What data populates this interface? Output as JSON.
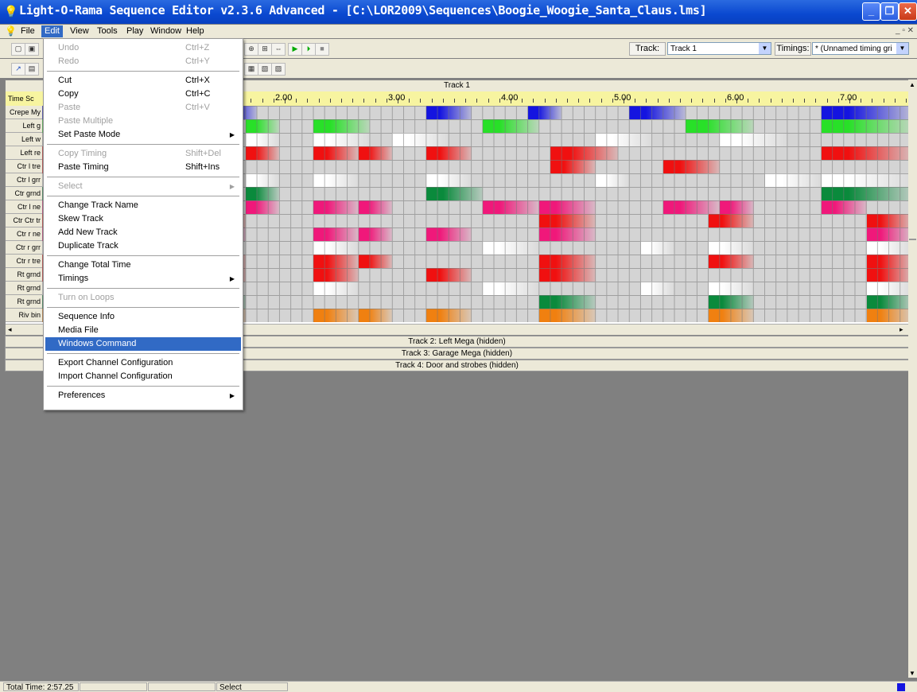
{
  "window": {
    "title": "Light-O-Rama Sequence Editor v2.3.6 Advanced - [C:\\LOR2009\\Sequences\\Boogie_Woogie_Santa_Claus.lms]"
  },
  "menubar": [
    "File",
    "Edit",
    "View",
    "Tools",
    "Play",
    "Window",
    "Help"
  ],
  "toolbar": {
    "track_label": "Track:",
    "track_value": "Track 1",
    "timings_label": "Timings:",
    "timings_value": "* (Unnamed timing gri"
  },
  "editor": {
    "track_title": "Track 1",
    "timescale_label": "Time Sc",
    "time_ticks": [
      "2.00",
      "3.00",
      "4.00",
      "5.00",
      "6.00",
      "7.00"
    ],
    "channel_labels": [
      "Crepe My",
      "Left g",
      "Left w",
      "Left re",
      "Ctr l tre",
      "Ctr l grr",
      "Ctr grnd",
      "Ctr l ne",
      "Ctr Ctr tr",
      "Ctr r ne",
      "Ctr r grr",
      "Ctr r tre",
      "Rt grnd",
      "Rt grnd",
      "Rt grnd",
      "Riv bin"
    ],
    "hidden_tracks": [
      "Track 2: Left Mega (hidden)",
      "Track 3: Garage Mega (hidden)",
      "Track 4: Door and strobes (hidden)"
    ]
  },
  "status": {
    "total_time": "Total Time: 2:57.25",
    "mode": "Select"
  },
  "edit_menu": [
    {
      "label": "Undo",
      "shortcut": "Ctrl+Z",
      "disabled": true
    },
    {
      "label": "Redo",
      "shortcut": "Ctrl+Y",
      "disabled": true
    },
    {
      "sep": true
    },
    {
      "label": "Cut",
      "shortcut": "Ctrl+X"
    },
    {
      "label": "Copy",
      "shortcut": "Ctrl+C"
    },
    {
      "label": "Paste",
      "shortcut": "Ctrl+V",
      "disabled": true
    },
    {
      "label": "Paste Multiple",
      "disabled": true
    },
    {
      "label": "Set Paste Mode",
      "submenu": true
    },
    {
      "sep": true
    },
    {
      "label": "Copy Timing",
      "shortcut": "Shift+Del",
      "disabled": true
    },
    {
      "label": "Paste Timing",
      "shortcut": "Shift+Ins"
    },
    {
      "sep": true
    },
    {
      "label": "Select",
      "submenu": true,
      "disabled": true
    },
    {
      "sep": true
    },
    {
      "label": "Change Track Name"
    },
    {
      "label": "Skew Track"
    },
    {
      "label": "Add New Track"
    },
    {
      "label": "Duplicate Track"
    },
    {
      "sep": true
    },
    {
      "label": "Change Total Time"
    },
    {
      "label": "Timings",
      "submenu": true
    },
    {
      "sep": true
    },
    {
      "label": "Turn on Loops",
      "disabled": true
    },
    {
      "sep": true
    },
    {
      "label": "Sequence Info"
    },
    {
      "label": "Media File"
    },
    {
      "label": "Windows Command",
      "highlighted": true
    },
    {
      "sep": true
    },
    {
      "label": "Export Channel Configuration"
    },
    {
      "label": "Import Channel Configuration"
    },
    {
      "sep": true
    },
    {
      "label": "Preferences",
      "submenu": true
    }
  ],
  "colors": {
    "blue": "#1414e0",
    "green": "#28e028",
    "white": "#ffffff",
    "red": "#f01010",
    "darkgreen": "#0a8a3c",
    "pink": "#f0187a",
    "orange": "#f08010",
    "grid_bg": "#d4d4d4"
  }
}
